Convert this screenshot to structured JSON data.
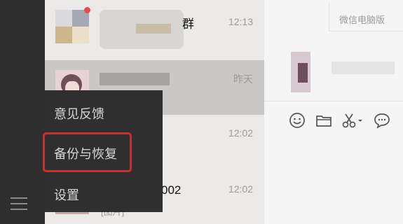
{
  "chat_list": {
    "items": [
      {
        "time": "12:13",
        "name": "群",
        "name_visible": "…群"
      },
      {
        "time": "昨天"
      },
      {
        "time": "12:02"
      },
      {
        "time": "12:02",
        "name": "002",
        "preview": "[图片]"
      }
    ]
  },
  "popup_menu": {
    "items": [
      {
        "label": "意见反馈"
      },
      {
        "label": "备份与恢复"
      },
      {
        "label": "设置"
      }
    ]
  },
  "window": {
    "title_button": "微信电脑版"
  },
  "toolbar": {
    "icons": [
      "emoji-icon",
      "folder-icon",
      "scissors-icon",
      "chat-bubble-icon"
    ]
  },
  "colors": {
    "sidebar_bg": "#2e2e2e",
    "popup_bg": "#2f2f2f",
    "highlight": "#e8231e",
    "selected_row": "#c9c8c6"
  }
}
